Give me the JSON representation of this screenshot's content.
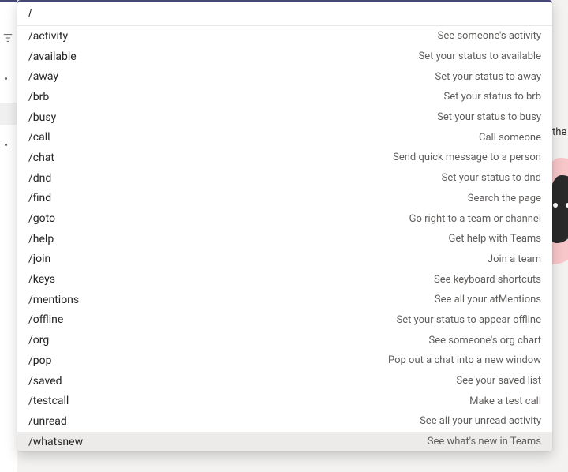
{
  "search": {
    "value": "/"
  },
  "commands": [
    {
      "name": "/activity",
      "desc": "See someone's activity",
      "highlight": false
    },
    {
      "name": "/available",
      "desc": "Set your status to available",
      "highlight": false
    },
    {
      "name": "/away",
      "desc": "Set your status to away",
      "highlight": false
    },
    {
      "name": "/brb",
      "desc": "Set your status to brb",
      "highlight": false
    },
    {
      "name": "/busy",
      "desc": "Set your status to busy",
      "highlight": false
    },
    {
      "name": "/call",
      "desc": "Call someone",
      "highlight": false
    },
    {
      "name": "/chat",
      "desc": "Send quick message to a person",
      "highlight": false
    },
    {
      "name": "/dnd",
      "desc": "Set your status to dnd",
      "highlight": false
    },
    {
      "name": "/find",
      "desc": "Search the page",
      "highlight": false
    },
    {
      "name": "/goto",
      "desc": "Go right to a team or channel",
      "highlight": false
    },
    {
      "name": "/help",
      "desc": "Get help with Teams",
      "highlight": false
    },
    {
      "name": "/join",
      "desc": "Join a team",
      "highlight": false
    },
    {
      "name": "/keys",
      "desc": "See keyboard shortcuts",
      "highlight": false
    },
    {
      "name": "/mentions",
      "desc": "See all your atMentions",
      "highlight": false
    },
    {
      "name": "/offline",
      "desc": "Set your status to appear offline",
      "highlight": false
    },
    {
      "name": "/org",
      "desc": "See someone's org chart",
      "highlight": false
    },
    {
      "name": "/pop",
      "desc": "Pop out a chat into a new window",
      "highlight": false
    },
    {
      "name": "/saved",
      "desc": "See your saved list",
      "highlight": false
    },
    {
      "name": "/testcall",
      "desc": "Make a test call",
      "highlight": false
    },
    {
      "name": "/unread",
      "desc": "See all your unread activity",
      "highlight": false
    },
    {
      "name": "/whatsnew",
      "desc": "See what's new in Teams",
      "highlight": true
    }
  ],
  "truncated_right_text": "the"
}
